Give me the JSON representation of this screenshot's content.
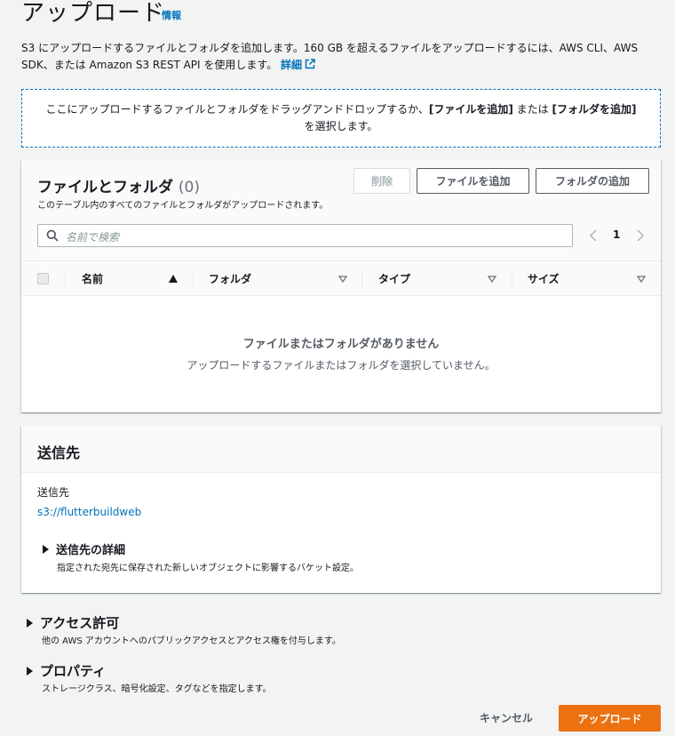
{
  "page": {
    "title": "アップロード",
    "info_link": "情報",
    "description": "S3 にアップロードするファイルとフォルダを追加します。160 GB を超えるファイルをアップロードするには、AWS CLI、AWS SDK、または Amazon S3 REST API を使用します。",
    "description_link": "詳細"
  },
  "dropzone": {
    "text_before": "ここにアップロードするファイルとフォルダをドラッグアンドドロップするか、",
    "add_files": "[ファイルを追加]",
    "or": " または ",
    "add_folder": "[フォルダを追加]",
    "text_after": " を選択します。"
  },
  "files_panel": {
    "title": "ファイルとフォルダ",
    "count": "(0)",
    "subtitle": "このテーブル内のすべてのファイルとフォルダがアップロードされます。",
    "delete_button": "削除",
    "add_files_button": "ファイルを追加",
    "add_folder_button": "フォルダの追加",
    "search_placeholder": "名前で検索",
    "page_number": "1",
    "columns": [
      "名前",
      "フォルダ",
      "タイプ",
      "サイズ"
    ],
    "empty_title": "ファイルまたはフォルダがありません",
    "empty_subtitle": "アップロードするファイルまたはフォルダを選択していません。"
  },
  "destination": {
    "title": "送信先",
    "label": "送信先",
    "path": "s3://flutterbuildweb",
    "details_title": "送信先の詳細",
    "details_desc": "指定された宛先に保存された新しいオブジェクトに影響するバケット設定。"
  },
  "permissions": {
    "title": "アクセス許可",
    "desc": "他の AWS アカウントへのパブリックアクセスとアクセス権を付与します。"
  },
  "properties": {
    "title": "プロパティ",
    "desc": "ストレージクラス、暗号化設定、タグなどを指定します。"
  },
  "footer": {
    "cancel": "キャンセル",
    "upload": "アップロード"
  },
  "colors": {
    "link": "#0073bb",
    "primary_button": "#ec7211",
    "background": "#f2f3f3"
  }
}
